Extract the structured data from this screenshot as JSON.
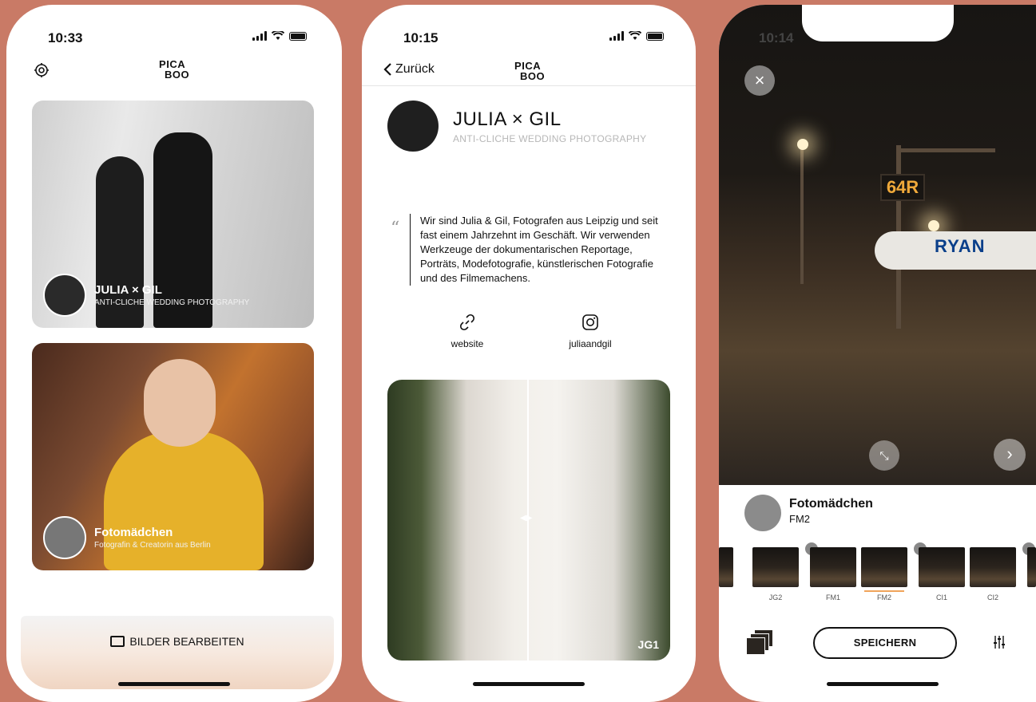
{
  "screen1": {
    "time": "10:33",
    "logo_line1": "PICA",
    "logo_line2": "BOO",
    "cards": [
      {
        "title": "JULIA × GIL",
        "subtitle": "ANTI-CLICHE WEDDING PHOTOGRAPHY"
      },
      {
        "title": "Fotomädchen",
        "subtitle": "Fotografin & Creatorin aus Berlin"
      }
    ],
    "edit_button": "BILDER BEARBEITEN"
  },
  "screen2": {
    "time": "10:15",
    "back_label": "Zurück",
    "logo_line1": "PICA",
    "logo_line2": "BOO",
    "profile_name": "JULIA × GIL",
    "profile_subtitle": "ANTI-CLICHE WEDDING PHOTOGRAPHY",
    "quote_mark": "“",
    "quote": "Wir sind Julia & Gil, Fotografen aus Leipzig und seit fast einem Jahrzehnt im Geschäft. Wir verwenden Werkzeuge der dokumentarischen Reportage, Porträts, Modefotografie, künstlerischen Fotografie und des Filmemachens.",
    "links": [
      {
        "label": "website",
        "icon": "link-icon"
      },
      {
        "label": "juliaandgil",
        "icon": "instagram-icon"
      }
    ],
    "compare_label": "JG1"
  },
  "screen3": {
    "time": "10:14",
    "sign_text": "64R",
    "plane_text": "RYAN",
    "creator_name": "Fotomädchen",
    "creator_preset": "FM2",
    "filters": [
      "JG2",
      "FM1",
      "FM2",
      "CI1",
      "CI2"
    ],
    "active_filter": "FM2",
    "save_button": "SPEICHERN",
    "accent_color": "#f0a45a"
  }
}
